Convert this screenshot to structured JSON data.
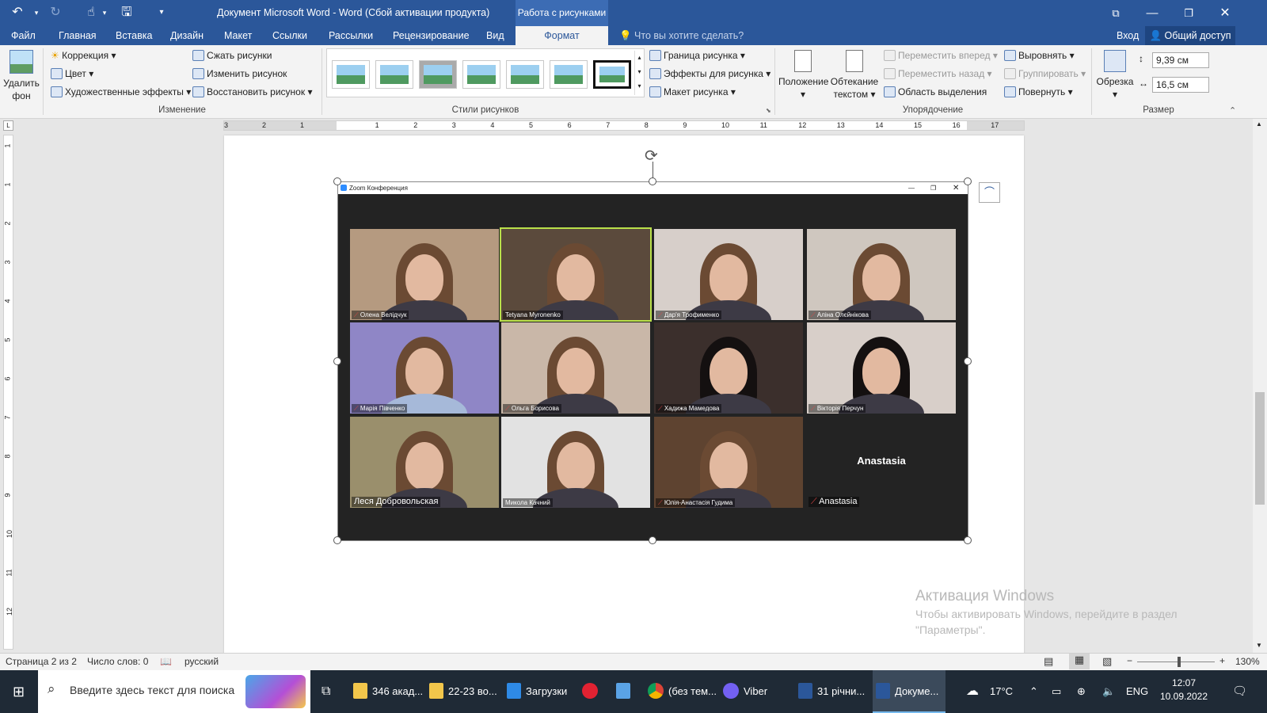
{
  "titlebar": {
    "title": "Документ Microsoft Word - Word (Сбой активации продукта)",
    "context_tab": "Работа с рисунками",
    "icons": [
      "undo-icon",
      "redo-icon",
      "touch-mode-icon",
      "save-icon",
      "customize-icon",
      "ribbon-display-icon",
      "minimize-icon",
      "restore-icon",
      "close-icon"
    ]
  },
  "tabs": [
    "Файл",
    "Главная",
    "Вставка",
    "Дизайн",
    "Макет",
    "Ссылки",
    "Рассылки",
    "Рецензирование",
    "Вид",
    "Формат"
  ],
  "tell_me": "Что вы хотите сделать?",
  "signin": "Вход",
  "share": "Общий доступ",
  "ribbon": {
    "remove_bg_line1": "Удалить",
    "remove_bg_line2": "фон",
    "correction": "Коррекция",
    "color": "Цвет",
    "art_effects": "Художественные эффекты",
    "compress": "Сжать рисунки",
    "change": "Изменить рисунок",
    "reset": "Восстановить рисунок",
    "group_adjust": "Изменение",
    "group_styles": "Стили рисунков",
    "border": "Граница рисунка",
    "effects": "Эффекты для рисунка",
    "layout": "Макет рисунка",
    "position": "Положение",
    "wrap_line1": "Обтекание",
    "wrap_line2": "текстом",
    "bring_forward": "Переместить вперед",
    "send_backward": "Переместить назад",
    "selection_pane": "Область выделения",
    "align": "Выровнять",
    "group": "Группировать",
    "rotate": "Повернуть",
    "group_arrange": "Упорядочение",
    "crop": "Обрезка",
    "height": "9,39 см",
    "width": "16,5 см",
    "group_size": "Размер"
  },
  "ruler_numbers": [
    "3",
    "2",
    "1",
    "1",
    "2",
    "3",
    "4",
    "5",
    "6",
    "7",
    "8",
    "9",
    "10",
    "11",
    "12",
    "13",
    "14",
    "15",
    "16",
    "17"
  ],
  "vruler_numbers": [
    "1",
    "1",
    "2",
    "3",
    "4",
    "5",
    "6",
    "7",
    "8",
    "9",
    "10",
    "11",
    "12"
  ],
  "zoom": {
    "window_title": "Zoom Конференция",
    "tiles": [
      {
        "name": "Олена Велідчук",
        "bg": "#b59a80"
      },
      {
        "name": "Tetyana Myronenko",
        "bg": "#5b4a3c"
      },
      {
        "name": "Дар'я Трофименко",
        "bg": "#d7cfca"
      },
      {
        "name": "Аліна Олєйнікова",
        "bg": "#cfc7bf"
      },
      {
        "name": "Марія Півченко",
        "bg": "#8f86c6"
      },
      {
        "name": "Ольга Борисова",
        "bg": "#c9b7a8"
      },
      {
        "name": "Хадижа Мамедова",
        "bg": "#3b2f2c"
      },
      {
        "name": "Вікторія Перчун",
        "bg": "#d8cfc9"
      },
      {
        "name": "Леся Добровольская",
        "bg": "#9a8f6c"
      },
      {
        "name": "Микола Качний",
        "bg": "#e2e2e2"
      },
      {
        "name": "Юлія-Анастасія Гудима",
        "bg": "#5e4330"
      },
      {
        "name": "Anastasia",
        "bg": "#232323"
      }
    ],
    "anastasia_center": "Anastasia"
  },
  "watermark": {
    "title": "Активация Windows",
    "line1": "Чтобы активировать Windows, перейдите в раздел",
    "line2": "\"Параметры\"."
  },
  "status": {
    "page": "Страница 2 из 2",
    "words": "Число слов: 0",
    "lang": "русский",
    "zoom": "130%",
    "minus": "−",
    "plus": "+"
  },
  "taskbar": {
    "search": "Введите здесь текст для поиска",
    "apps": [
      "346 акад...",
      "22-23 во...",
      "Загрузки",
      "(без тем...",
      "Viber",
      "31 річни...",
      "Докуме..."
    ],
    "weather": "17°C",
    "lang": "ENG",
    "time": "12:07",
    "date": "10.09.2022"
  }
}
